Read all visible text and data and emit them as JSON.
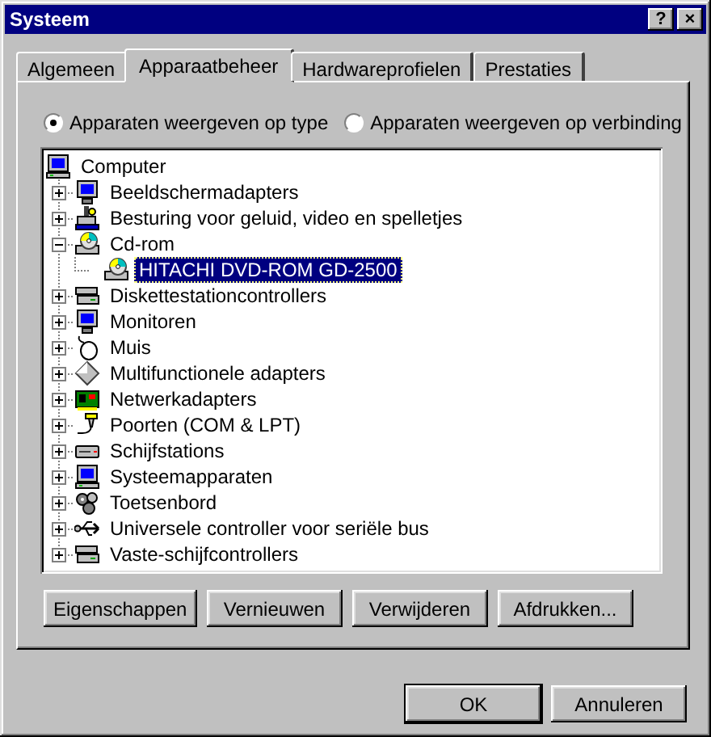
{
  "window": {
    "title": "Systeem",
    "title_buttons": [
      "?",
      "×"
    ]
  },
  "tabs": [
    {
      "label": "Algemeen",
      "selected": false
    },
    {
      "label": "Apparaatbeheer",
      "selected": true
    },
    {
      "label": "Hardwareprofielen",
      "selected": false
    },
    {
      "label": "Prestaties",
      "selected": false
    }
  ],
  "view_options": [
    {
      "label": "Apparaten weergeven op type",
      "selected": true
    },
    {
      "label": "Apparaten weergeven op verbinding",
      "selected": false
    }
  ],
  "device_tree": {
    "label": "Computer",
    "kind": "computer",
    "selected": false,
    "children": [
      {
        "label": "Beeldschermadapters",
        "kind": "monitor",
        "expanded": false,
        "selected": false
      },
      {
        "label": "Besturing voor geluid, video en spelletjes",
        "kind": "sound",
        "expanded": false,
        "selected": false
      },
      {
        "label": "Cd-rom",
        "kind": "cdrom",
        "expanded": true,
        "selected": false,
        "children": [
          {
            "label": "HITACHI DVD-ROM GD-2500",
            "kind": "cdrom",
            "selected": true
          }
        ]
      },
      {
        "label": "Diskettestationcontrollers",
        "kind": "controller",
        "expanded": false,
        "selected": false
      },
      {
        "label": "Monitoren",
        "kind": "monitor",
        "expanded": false,
        "selected": false
      },
      {
        "label": "Muis",
        "kind": "mouse",
        "expanded": false,
        "selected": false
      },
      {
        "label": "Multifunctionele adapters",
        "kind": "multifunction",
        "expanded": false,
        "selected": false
      },
      {
        "label": "Netwerkadapters",
        "kind": "network",
        "expanded": false,
        "selected": false
      },
      {
        "label": "Poorten (COM & LPT)",
        "kind": "port",
        "expanded": false,
        "selected": false
      },
      {
        "label": "Schijfstations",
        "kind": "drive",
        "expanded": false,
        "selected": false
      },
      {
        "label": "Systeemapparaten",
        "kind": "computer",
        "expanded": false,
        "selected": false
      },
      {
        "label": "Toetsenbord",
        "kind": "keyboard",
        "expanded": false,
        "selected": false
      },
      {
        "label": "Universele controller voor seriële bus",
        "kind": "usb",
        "expanded": false,
        "selected": false
      },
      {
        "label": "Vaste-schijfcontrollers",
        "kind": "controller",
        "expanded": false,
        "selected": false
      }
    ]
  },
  "actions": [
    "Eigenschappen",
    "Vernieuwen",
    "Verwijderen",
    "Afdrukken..."
  ],
  "dialog_buttons": [
    {
      "label": "OK",
      "kind": "default"
    },
    {
      "label": "Annuleren",
      "kind": "normal"
    }
  ]
}
